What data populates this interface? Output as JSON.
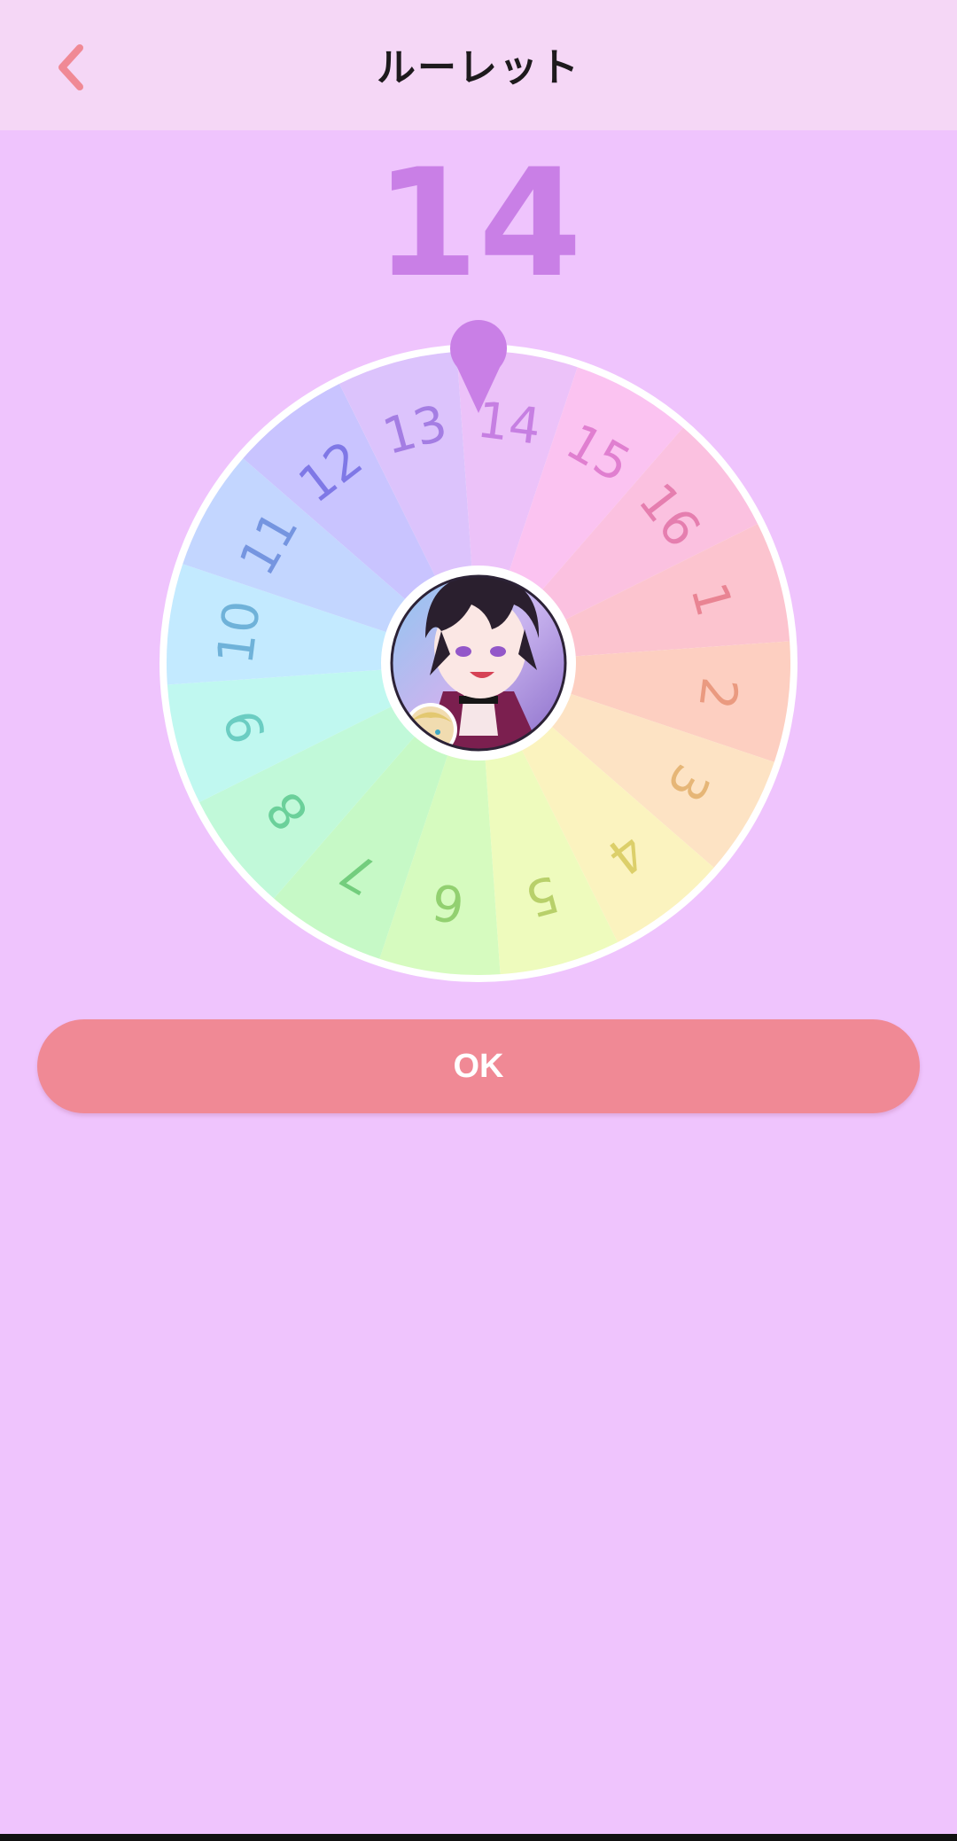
{
  "header": {
    "title": "ルーレット",
    "back_icon": "chevron-left-icon"
  },
  "result": {
    "value": "14"
  },
  "roulette": {
    "selected": "14",
    "center_image": "avatar-illustration",
    "segments": [
      {
        "label": "14",
        "color": "#ecc2f9",
        "text_color": "#c67fe2"
      },
      {
        "label": "15",
        "color": "#fbc3f1",
        "text_color": "#e07fd0"
      },
      {
        "label": "16",
        "color": "#fbc1e0",
        "text_color": "#e57eaf"
      },
      {
        "label": "1",
        "color": "#fcc4cf",
        "text_color": "#e98493"
      },
      {
        "label": "2",
        "color": "#fdcfc1",
        "text_color": "#ea9a80"
      },
      {
        "label": "3",
        "color": "#fde3c4",
        "text_color": "#e6b677"
      },
      {
        "label": "4",
        "color": "#fbf3bf",
        "text_color": "#dccf6a"
      },
      {
        "label": "5",
        "color": "#eefbbd",
        "text_color": "#b8d06a"
      },
      {
        "label": "6",
        "color": "#d6fbbf",
        "text_color": "#92d070"
      },
      {
        "label": "7",
        "color": "#c6f9c6",
        "text_color": "#73cd7d"
      },
      {
        "label": "8",
        "color": "#c1f9d9",
        "text_color": "#6bd09a"
      },
      {
        "label": "9",
        "color": "#c0f8f0",
        "text_color": "#6bcdc2"
      },
      {
        "label": "10",
        "color": "#c3eaff",
        "text_color": "#6fb2d9"
      },
      {
        "label": "11",
        "color": "#c3d6ff",
        "text_color": "#7595e0"
      },
      {
        "label": "12",
        "color": "#c9c4ff",
        "text_color": "#7f78e6"
      },
      {
        "label": "13",
        "color": "#dcc3fc",
        "text_color": "#a47de3"
      }
    ]
  },
  "ok_button": {
    "label": "OK"
  },
  "colors": {
    "background": "#efc4fd",
    "header": "#f5d7f6",
    "accent": "#c97fe6",
    "button": "#f08995",
    "pointer": "#c97fe6"
  }
}
